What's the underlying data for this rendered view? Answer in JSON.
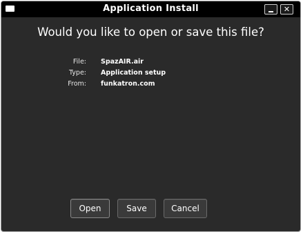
{
  "window": {
    "title": "Application Install",
    "minimize_label": "_",
    "close_label": "✕"
  },
  "prompt": {
    "question": "Would you like to open or save this file?"
  },
  "file_info": {
    "file_label": "File:",
    "file_value": "SpazAIR.air",
    "type_label": "Type:",
    "type_value": "Application setup",
    "from_label": "From:",
    "from_value": "funkatron.com"
  },
  "buttons": {
    "open": "Open",
    "save": "Save",
    "cancel": "Cancel"
  }
}
